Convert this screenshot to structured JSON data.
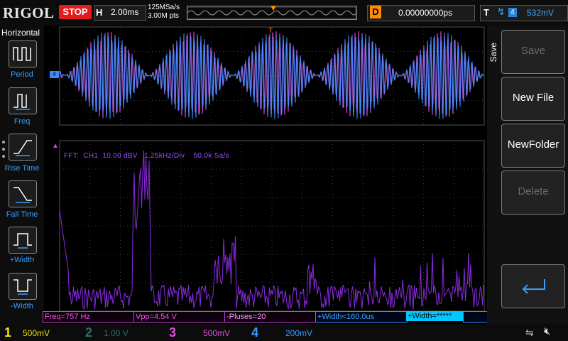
{
  "header": {
    "logo": "RIGOL",
    "run_state": "STOP",
    "timebase_key": "H",
    "timebase_value": "2.00ms",
    "sample_rate": "125MSa/s",
    "memory_depth": "3.00M pts",
    "delay_key": "D",
    "delay_value": "0.00000000ps",
    "trigger_key": "T",
    "trigger_source": "4",
    "trigger_level": "532mV"
  },
  "left_menu": {
    "title": "Horizontal",
    "items": [
      {
        "label": "Period"
      },
      {
        "label": "Freq"
      },
      {
        "label": "Rise Time"
      },
      {
        "label": "Fall Time"
      },
      {
        "label": "+Width"
      },
      {
        "label": "-Width"
      }
    ]
  },
  "scope": {
    "ch_marker": "4",
    "fft_info": "FFT:  CH1  10.00 dBV   1.25kHz/Div    50.0k Sa/s",
    "trigger_marker": "T"
  },
  "measurements": [
    {
      "text": "Freq=757 Hz"
    },
    {
      "text": "Vpp=4.54 V"
    },
    {
      "text": "-Pluses=20"
    },
    {
      "text": "+Width<160.0us"
    },
    {
      "text": "+Width=*****"
    }
  ],
  "right_menu": {
    "title": "Save",
    "buttons": [
      {
        "label": "Save",
        "enabled": false
      },
      {
        "label": "New File",
        "enabled": true
      },
      {
        "label": "NewFolder",
        "enabled": true
      },
      {
        "label": "Delete",
        "enabled": false
      }
    ]
  },
  "channels": [
    {
      "num": "1",
      "scale": "500mV",
      "color": "#f2e20f"
    },
    {
      "num": "2",
      "scale": "1.00 V",
      "color": "#2f6e6e"
    },
    {
      "num": "3",
      "scale": "500mV",
      "color": "#e04fe0"
    },
    {
      "num": "4",
      "scale": "200mV",
      "color": "#3a9cff"
    }
  ]
}
